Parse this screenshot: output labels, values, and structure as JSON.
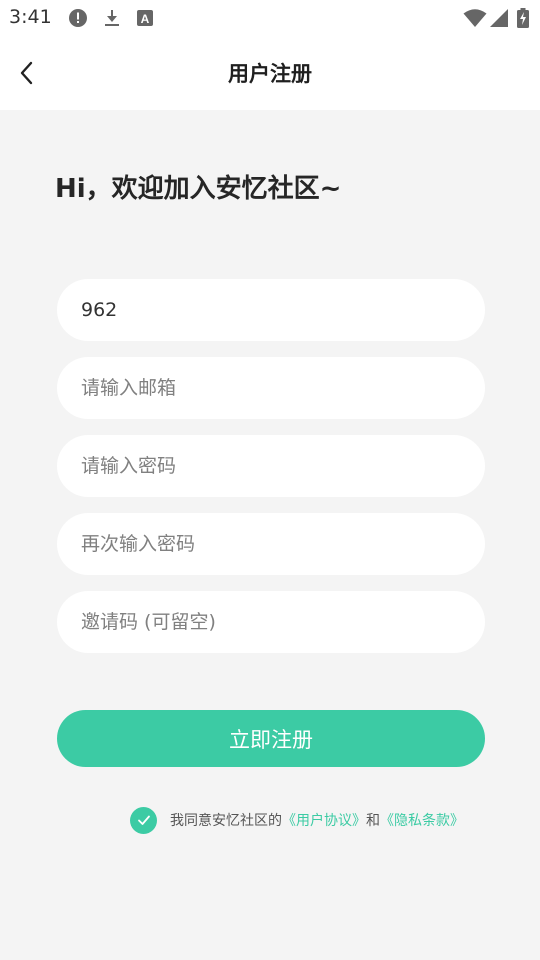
{
  "status_bar": {
    "time": "3:41",
    "left_icons": [
      "alert-icon",
      "download-icon",
      "font-icon"
    ],
    "right_icons": [
      "wifi-icon",
      "signal-icon",
      "battery-charging-icon"
    ]
  },
  "header": {
    "title": "用户注册",
    "back_icon": "chevron-left-icon"
  },
  "greeting": "Hi，欢迎加入安忆社区~",
  "form": {
    "username": {
      "value": "962",
      "placeholder": ""
    },
    "email": {
      "value": "",
      "placeholder": "请输入邮箱"
    },
    "password": {
      "value": "",
      "placeholder": "请输入密码"
    },
    "confirm_password": {
      "value": "",
      "placeholder": "再次输入密码"
    },
    "invite_code": {
      "value": "",
      "placeholder": "邀请码 (可留空)"
    },
    "submit_label": "立即注册"
  },
  "agreement": {
    "checked": true,
    "prefix": "我同意安忆社区的",
    "user_agreement": "《用户协议》",
    "and": "和",
    "privacy": "《隐私条款》"
  },
  "colors": {
    "accent": "#3ccba4",
    "background": "#f4f4f4",
    "surface": "#ffffff",
    "text": "#222222",
    "placeholder": "#808080"
  }
}
